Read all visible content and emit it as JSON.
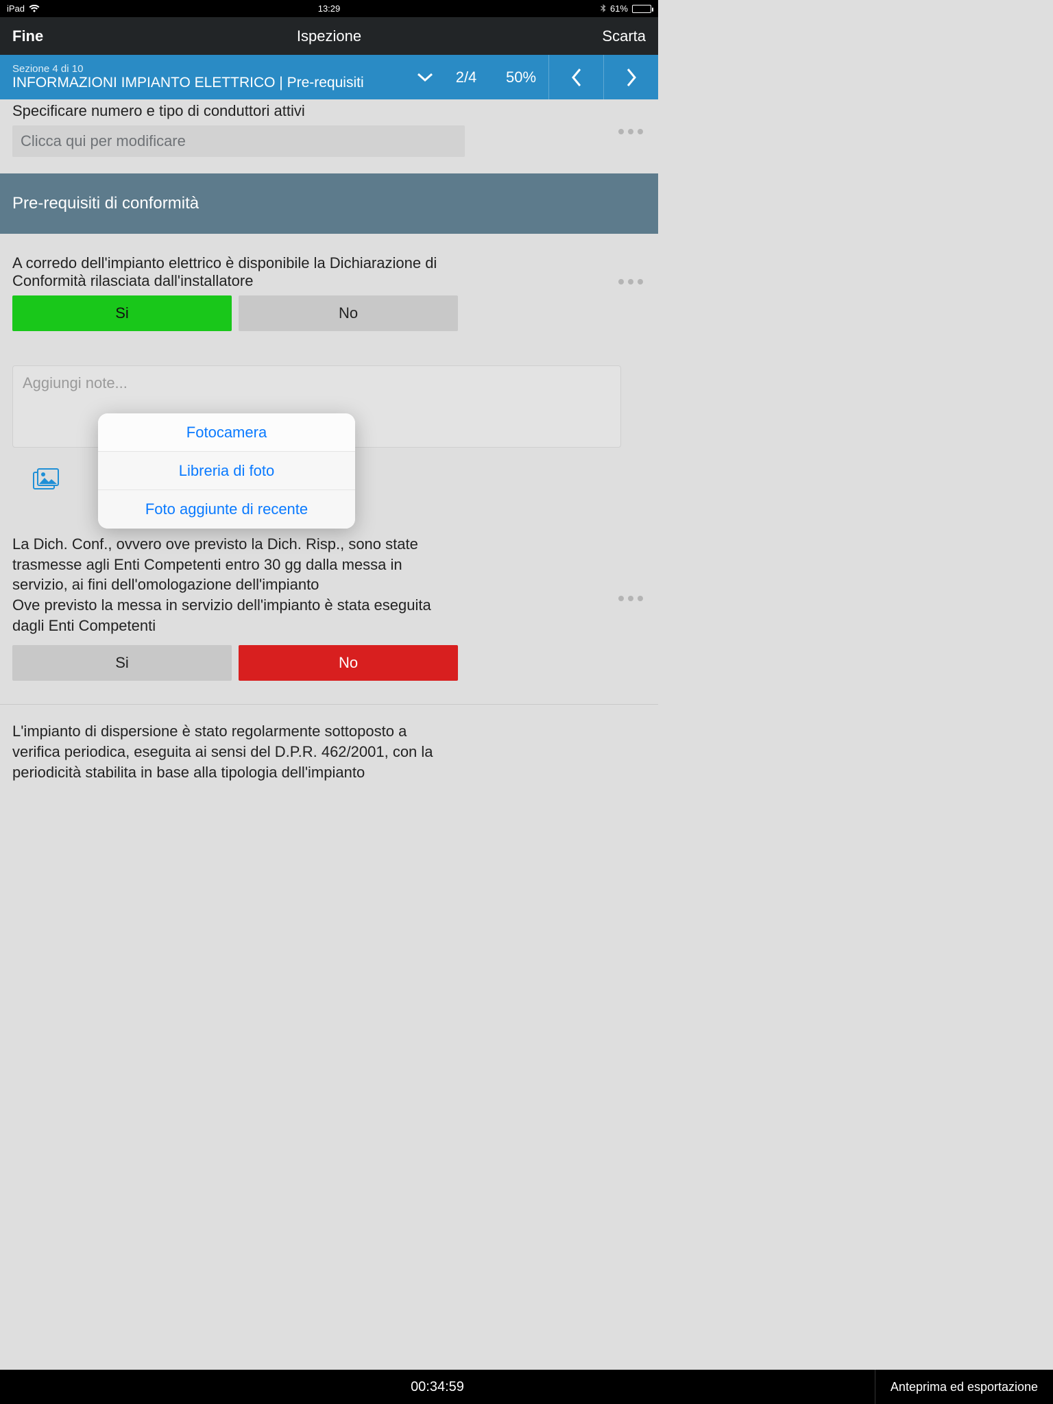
{
  "status": {
    "device": "iPad",
    "time": "13:29",
    "battery": "61%"
  },
  "nav": {
    "left": "Fine",
    "title": "Ispezione",
    "right": "Scarta"
  },
  "section": {
    "small": "Sezione 4 di 10",
    "title": "INFORMAZIONI IMPIANTO ELETTRICO | Pre-requisiti",
    "progress_count": "2/4",
    "progress_pct": "50%"
  },
  "q_spec": {
    "label": "Specificare numero e tipo di conduttori attivi",
    "placeholder": "Clicca qui per modificare"
  },
  "subheader": "Pre-requisiti di conformità",
  "q1": {
    "text": "A corredo dell'impianto elettrico è disponibile la Dichiarazione di Conformità rilasciata dall'installatore",
    "yes": "Si",
    "no": "No",
    "notes_placeholder": "Aggiungi note..."
  },
  "popover": {
    "camera": "Fotocamera",
    "library": "Libreria di foto",
    "recent": "Foto aggiunte di recente"
  },
  "q2": {
    "line1": "La Dich. Conf., ovvero ove previsto la Dich. Risp., sono state trasmesse agli Enti Competenti entro 30 gg dalla messa in servizio, ai fini dell'omologazione dell'impianto",
    "line2": "Ove previsto la messa in servizio dell'impianto è stata eseguita dagli Enti Competenti",
    "yes": "Si",
    "no": "No"
  },
  "q3": {
    "text": "L'impianto di dispersione è stato regolarmente sottoposto a verifica periodica, eseguita ai sensi del D.P.R. 462/2001, con la periodicità stabilita in base alla tipologia dell'impianto"
  },
  "bottom": {
    "timer": "00:34:59",
    "export": "Anteprima ed esportazione"
  }
}
